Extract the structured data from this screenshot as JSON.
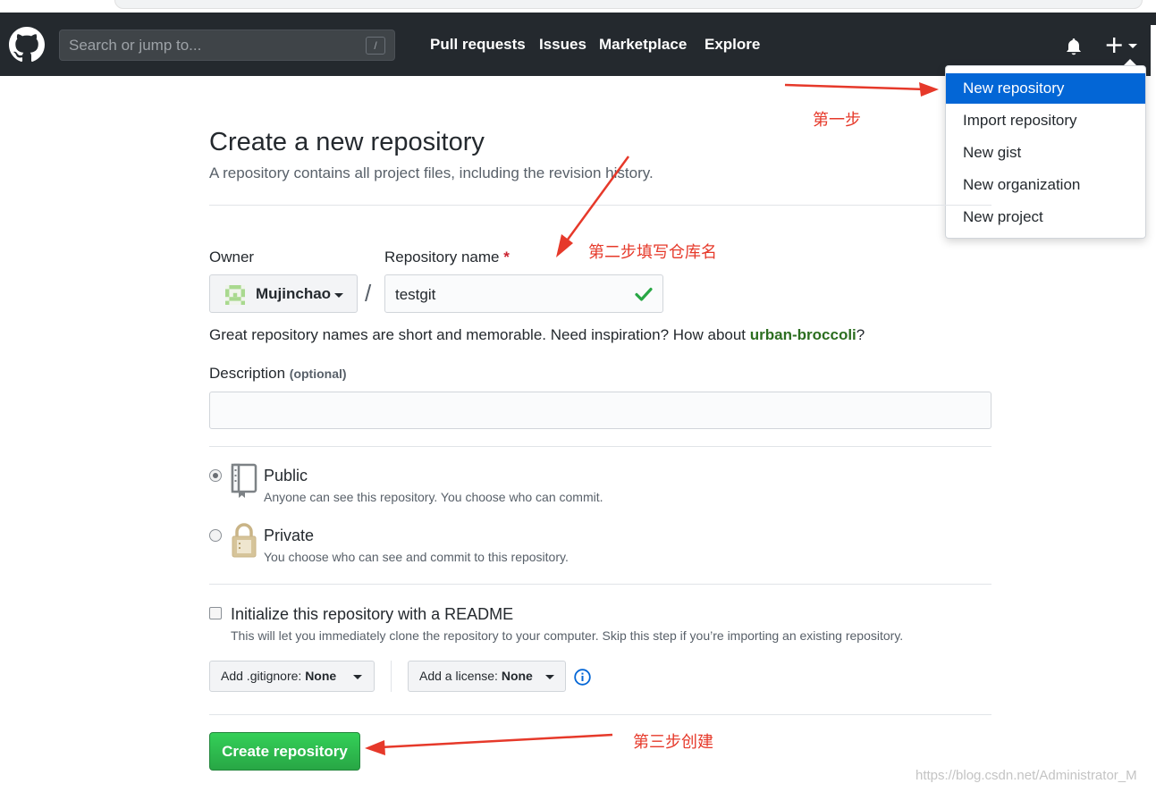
{
  "header": {
    "search_placeholder": "Search or jump to...",
    "search_shortcut": "/",
    "nav": [
      "Pull requests",
      "Issues",
      "Marketplace",
      "Explore"
    ]
  },
  "dropdown": {
    "items": [
      "New repository",
      "Import repository",
      "New gist",
      "New organization",
      "New project"
    ],
    "active_index": 0
  },
  "annotations": {
    "step1": "第一步",
    "step2": "第二步填写仓库名",
    "step3": "第三步创建"
  },
  "form": {
    "title": "Create a new repository",
    "subtitle": "A repository contains all project files, including the revision history.",
    "owner_label": "Owner",
    "owner_value": "Mujinchao",
    "name_label": "Repository name",
    "name_required": "*",
    "separator": "/",
    "name_value": "testgit",
    "hint_prefix": "Great repository names are short and memorable. Need inspiration? How about ",
    "hint_suggestion": "urban-broccoli",
    "hint_suffix": "?",
    "description_label": "Description",
    "description_optional": "(optional)",
    "description_value": "",
    "visibility": {
      "public_title": "Public",
      "public_desc": "Anyone can see this repository. You choose who can commit.",
      "private_title": "Private",
      "private_desc": "You choose who can see and commit to this repository.",
      "selected": "public"
    },
    "readme": {
      "title": "Initialize this repository with a README",
      "desc": "This will let you immediately clone the repository to your computer. Skip this step if you’re importing an existing repository.",
      "checked": false
    },
    "gitignore_label": "Add .gitignore:",
    "gitignore_value": "None",
    "license_label": "Add a license:",
    "license_value": "None",
    "create_label": "Create repository"
  },
  "watermark": "https://blog.csdn.net/Administrator_M",
  "colors": {
    "header_bg": "#24292e",
    "dropdown_active": "#0366d6",
    "annotation": "#e6392a",
    "create_button": "#28a745",
    "suggestion": "#2c6e20"
  }
}
